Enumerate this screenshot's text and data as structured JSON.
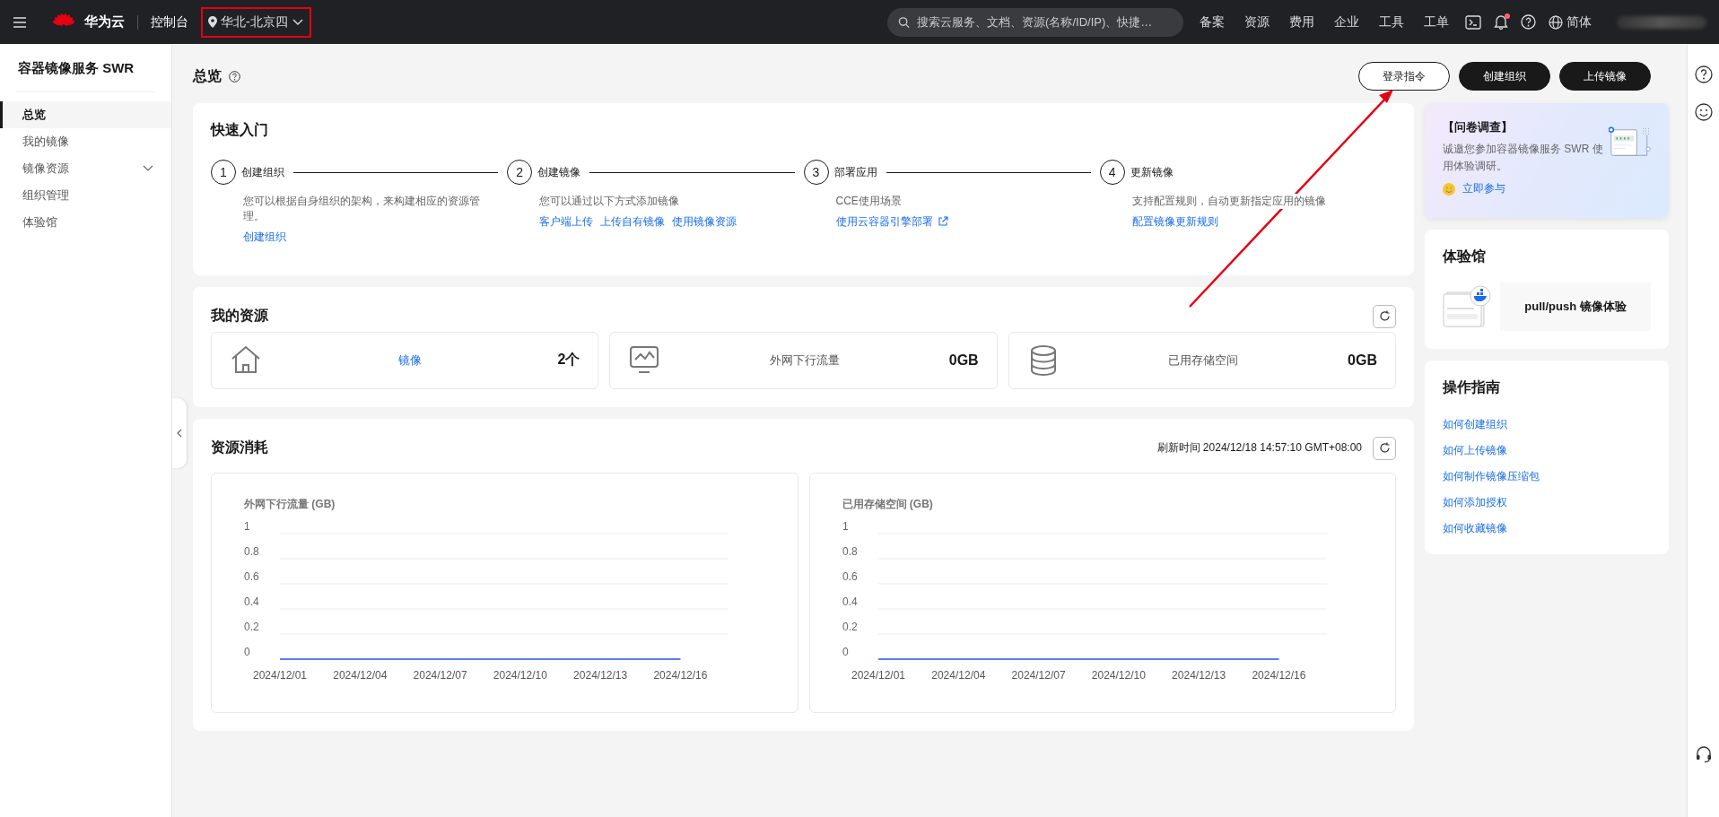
{
  "top_bar": {
    "brand": "华为云",
    "console": "控制台",
    "region": {
      "label": "华北-北京四",
      "highlighted": true
    },
    "search": {
      "placeholder": "搜索云服务、文档、资源(名称/ID/IP)、快捷…"
    },
    "nav": [
      "备案",
      "资源",
      "费用",
      "企业",
      "工具",
      "工单"
    ],
    "has_notification": true,
    "language": "简体"
  },
  "sidebar": {
    "title": "容器镜像服务 SWR",
    "items": [
      {
        "label": "总览",
        "selected": true,
        "kind": "link"
      },
      {
        "label": "我的镜像",
        "selected": false,
        "kind": "link"
      },
      {
        "label": "镜像资源",
        "selected": false,
        "kind": "group"
      },
      {
        "label": "组织管理",
        "selected": false,
        "kind": "link"
      },
      {
        "label": "体验馆",
        "selected": false,
        "kind": "link"
      }
    ]
  },
  "page": {
    "title": "总览",
    "buttons": [
      {
        "label": "登录指令",
        "kind": "outline"
      },
      {
        "label": "创建组织",
        "kind": "primary"
      },
      {
        "label": "上传镜像",
        "kind": "primary"
      }
    ]
  },
  "quick_start": {
    "title": "快速入门",
    "steps": [
      {
        "number": "1",
        "title": "创建组织",
        "description": "您可以根据自身组织的架构，来构建相应的资源管理。",
        "links": [
          {
            "label": "创建组织",
            "external": false
          }
        ]
      },
      {
        "number": "2",
        "title": "创建镜像",
        "description": "您可以通过以下方式添加镜像",
        "links": [
          {
            "label": "客户端上传",
            "external": false
          },
          {
            "label": "上传自有镜像",
            "external": false
          },
          {
            "label": "使用镜像资源",
            "external": false
          }
        ]
      },
      {
        "number": "3",
        "title": "部署应用",
        "description": "CCE使用场景",
        "links": [
          {
            "label": "使用云容器引擎部署",
            "external": true
          }
        ]
      },
      {
        "number": "4",
        "title": "更新镜像",
        "description": "支持配置规则，自动更新指定应用的镜像",
        "links": [
          {
            "label": "配置镜像更新规则",
            "external": false
          }
        ]
      }
    ]
  },
  "my_resources": {
    "title": "我的资源",
    "items": [
      {
        "kind": "image",
        "label": "镜像",
        "link": true,
        "value": "2个"
      },
      {
        "kind": "traffic",
        "label": "外网下行流量",
        "link": false,
        "value": "0GB"
      },
      {
        "kind": "storage",
        "label": "已用存储空间",
        "link": false,
        "value": "0GB"
      }
    ]
  },
  "consumption": {
    "title": "资源消耗",
    "refresh_time": "刷新时间 2024/12/18 14:57:10 GMT+08:00",
    "charts": [
      {
        "chart_data": {
          "type": "line",
          "title": "外网下行流量 (GB)",
          "categories": [
            "2024/12/01",
            "2024/12/04",
            "2024/12/07",
            "2024/12/10",
            "2024/12/13",
            "2024/12/16"
          ],
          "series": [
            {
              "color": "#5b7de8",
              "values": [
                0,
                0,
                0,
                0,
                0,
                0
              ]
            }
          ],
          "ylim": [
            0,
            1
          ],
          "yticks": [
            0,
            0.2,
            0.4,
            0.6,
            0.8,
            1
          ],
          "grid": true
        }
      },
      {
        "chart_data": {
          "type": "line",
          "title": "已用存储空间 (GB)",
          "categories": [
            "2024/12/01",
            "2024/12/04",
            "2024/12/07",
            "2024/12/10",
            "2024/12/13",
            "2024/12/16"
          ],
          "series": [
            {
              "color": "#5b7de8",
              "values": [
                0,
                0,
                0,
                0,
                0,
                0
              ]
            }
          ],
          "ylim": [
            0,
            1
          ],
          "yticks": [
            0,
            0.2,
            0.4,
            0.6,
            0.8,
            1
          ],
          "grid": true
        }
      }
    ]
  },
  "survey": {
    "title": "【问卷调查】",
    "text": "诚邀您参加容器镜像服务 SWR 使用体验调研。",
    "link": "立即参与"
  },
  "experience": {
    "title": "体验馆",
    "item": "pull/push 镜像体验"
  },
  "guides": {
    "title": "操作指南",
    "links": [
      "如何创建组织",
      "如何上传镜像",
      "如何制作镜像压缩包",
      "如何添加授权",
      "如何收藏镜像"
    ]
  },
  "annotations": [
    {
      "kind": "arrow"
    }
  ]
}
